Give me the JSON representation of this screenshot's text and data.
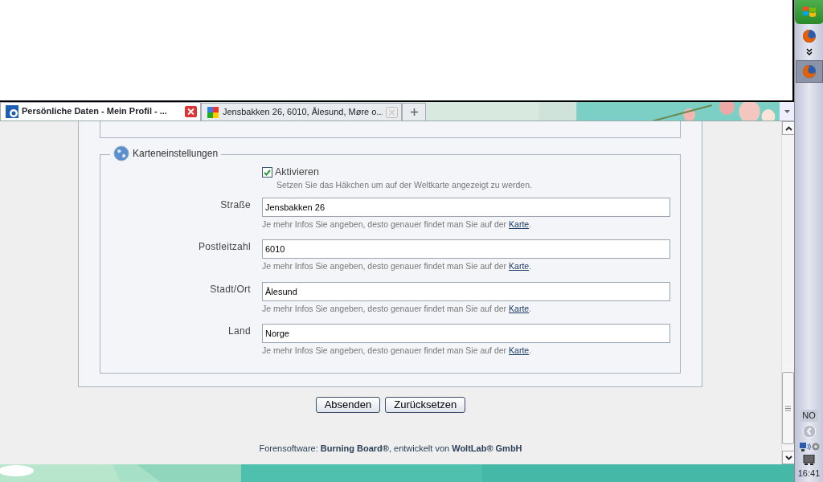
{
  "browser_tabs": [
    {
      "title": "Persönliche Daten - Mein Profil - ...",
      "selected": true,
      "kind": "forum"
    },
    {
      "title": "Jensbakken 26, 6010, Ålesund, Møre o...",
      "selected": false,
      "kind": "maps"
    }
  ],
  "map_settings": {
    "legend": "Karteneinstellungen",
    "activate": {
      "label": "Aktivieren",
      "checked": true,
      "hint": "Setzen Sie das Häkchen um auf der Weltkarte angezeigt zu werden."
    },
    "fields": [
      {
        "label": "Straße",
        "value": "Jensbakken 26",
        "hint": "Je mehr Infos Sie angeben, desto genauer findet man Sie auf der ",
        "link": "Karte",
        "hint_end": "."
      },
      {
        "label": "Postleitzahl",
        "value": "6010",
        "hint": "Je mehr Infos Sie angeben, desto genauer findet man Sie auf der ",
        "link": "Karte",
        "hint_end": "."
      },
      {
        "label": "Stadt/Ort",
        "value": "Ålesund",
        "hint": "Je mehr Infos Sie angeben, desto genauer findet man Sie auf der ",
        "link": "Karte",
        "hint_end": "."
      },
      {
        "label": "Land",
        "value": "Norge",
        "hint": "Je mehr Infos Sie angeben, desto genauer findet man Sie auf der ",
        "link": "Karte",
        "hint_end": "."
      }
    ]
  },
  "buttons": [
    "Absenden",
    "Zurücksetzen"
  ],
  "footer": "Forensoftware: **Burning Board®**, entwickelt von **WoltLab® GmbH**",
  "taskbar": {
    "language": "NO",
    "clock": "16:41"
  }
}
